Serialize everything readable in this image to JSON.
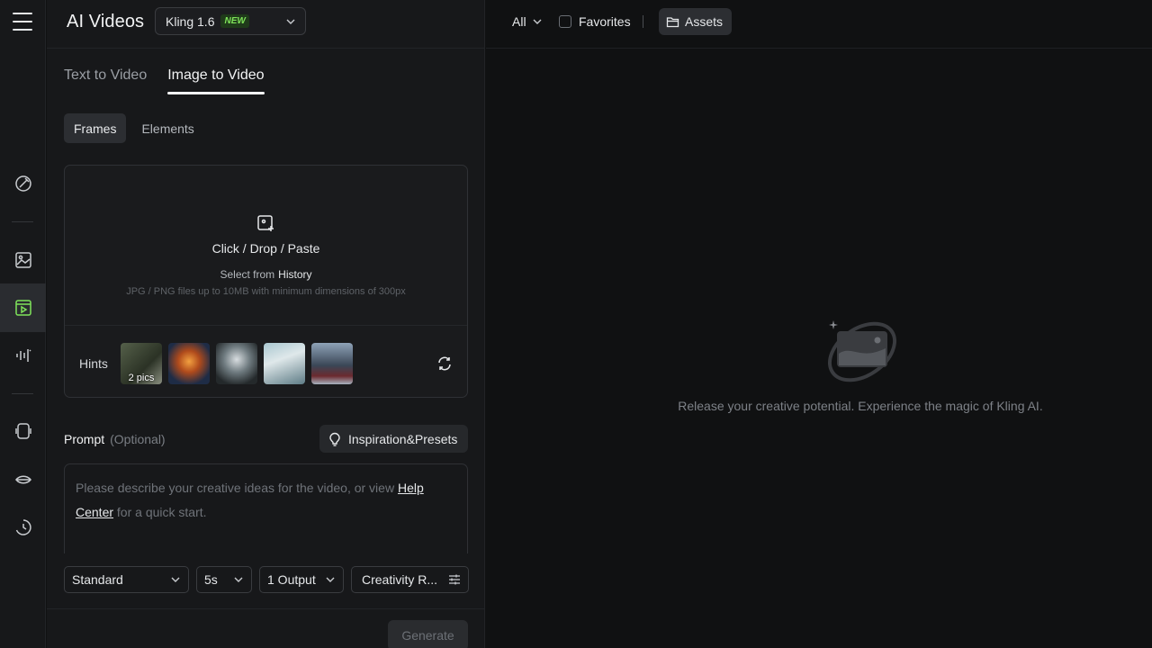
{
  "rail": {
    "items": [
      {
        "icon": "magic-edit-icon"
      },
      {
        "icon": "image-icon"
      },
      {
        "icon": "video-icon",
        "active": true
      },
      {
        "icon": "audio-wave-icon"
      },
      {
        "icon": "avatar-icon"
      },
      {
        "icon": "lips-icon"
      },
      {
        "icon": "history-icon"
      }
    ]
  },
  "header": {
    "title": "AI Videos",
    "model": "Kling 1.6",
    "model_badge": "NEW"
  },
  "tabs": [
    {
      "label": "Text to Video",
      "active": false
    },
    {
      "label": "Image to Video",
      "active": true
    }
  ],
  "segments": [
    {
      "label": "Frames",
      "active": true
    },
    {
      "label": "Elements",
      "active": false
    }
  ],
  "upload": {
    "action_text": "Click / Drop / Paste",
    "select_from": "Select from",
    "history_link": "History",
    "requirements": "JPG / PNG files up to 10MB with minimum dimensions of 300px"
  },
  "hints": {
    "label": "Hints",
    "thumbnails": [
      {
        "caption": "2 pics"
      },
      {
        "caption": ""
      },
      {
        "caption": ""
      },
      {
        "caption": ""
      },
      {
        "caption": ""
      }
    ]
  },
  "prompt": {
    "label": "Prompt",
    "optional": "(Optional)",
    "inspiration_button": "Inspiration&Presets",
    "placeholder_part1": "Please describe your creative ideas for the video, or view ",
    "help_link": "Help Center",
    "placeholder_part2": " for a quick start."
  },
  "controls": {
    "mode": "Standard",
    "duration": "5s",
    "outputs": "1 Output",
    "creativity": "Creativity R..."
  },
  "generate_label": "Generate",
  "right": {
    "filter": "All",
    "favorites": "Favorites",
    "assets": "Assets",
    "empty_message": "Release your creative potential. Experience the magic of Kling AI."
  },
  "colors": {
    "accent_green": "#7fe35a",
    "background": "#101112",
    "panel": "#17181a"
  }
}
